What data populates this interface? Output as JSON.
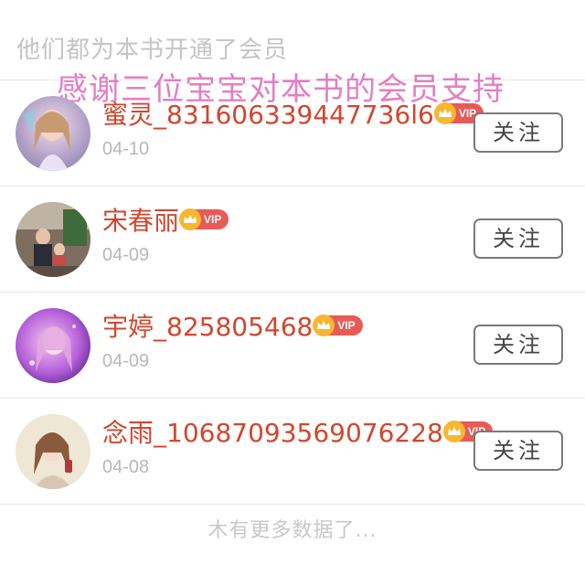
{
  "header": {
    "title": "他们都为本书开通了会员"
  },
  "overlay": {
    "text": "感谢三位宝宝对本书的会员支持"
  },
  "members": [
    {
      "name": "蜜灵_831606339447736l6",
      "vip": "VIP",
      "date": "04-10",
      "follow_label": "关注",
      "avatar": "avatar-princess"
    },
    {
      "name": "宋春丽",
      "vip": "VIP",
      "date": "04-09",
      "follow_label": "关注",
      "avatar": "avatar-family-photo"
    },
    {
      "name": "宇婷_825805468",
      "vip": "VIP",
      "date": "04-09",
      "follow_label": "关注",
      "avatar": "avatar-purple-anime"
    },
    {
      "name": "念雨_10687093569076228",
      "vip": "VIP",
      "date": "04-08",
      "follow_label": "关注",
      "avatar": "avatar-girl-illustration"
    }
  ],
  "footer": {
    "text": "木有更多数据了..."
  },
  "colors": {
    "name": "#d2462f",
    "vip_badge": "#e85a56",
    "crown": "#f5b82e",
    "overlay": "#e27fc4"
  }
}
